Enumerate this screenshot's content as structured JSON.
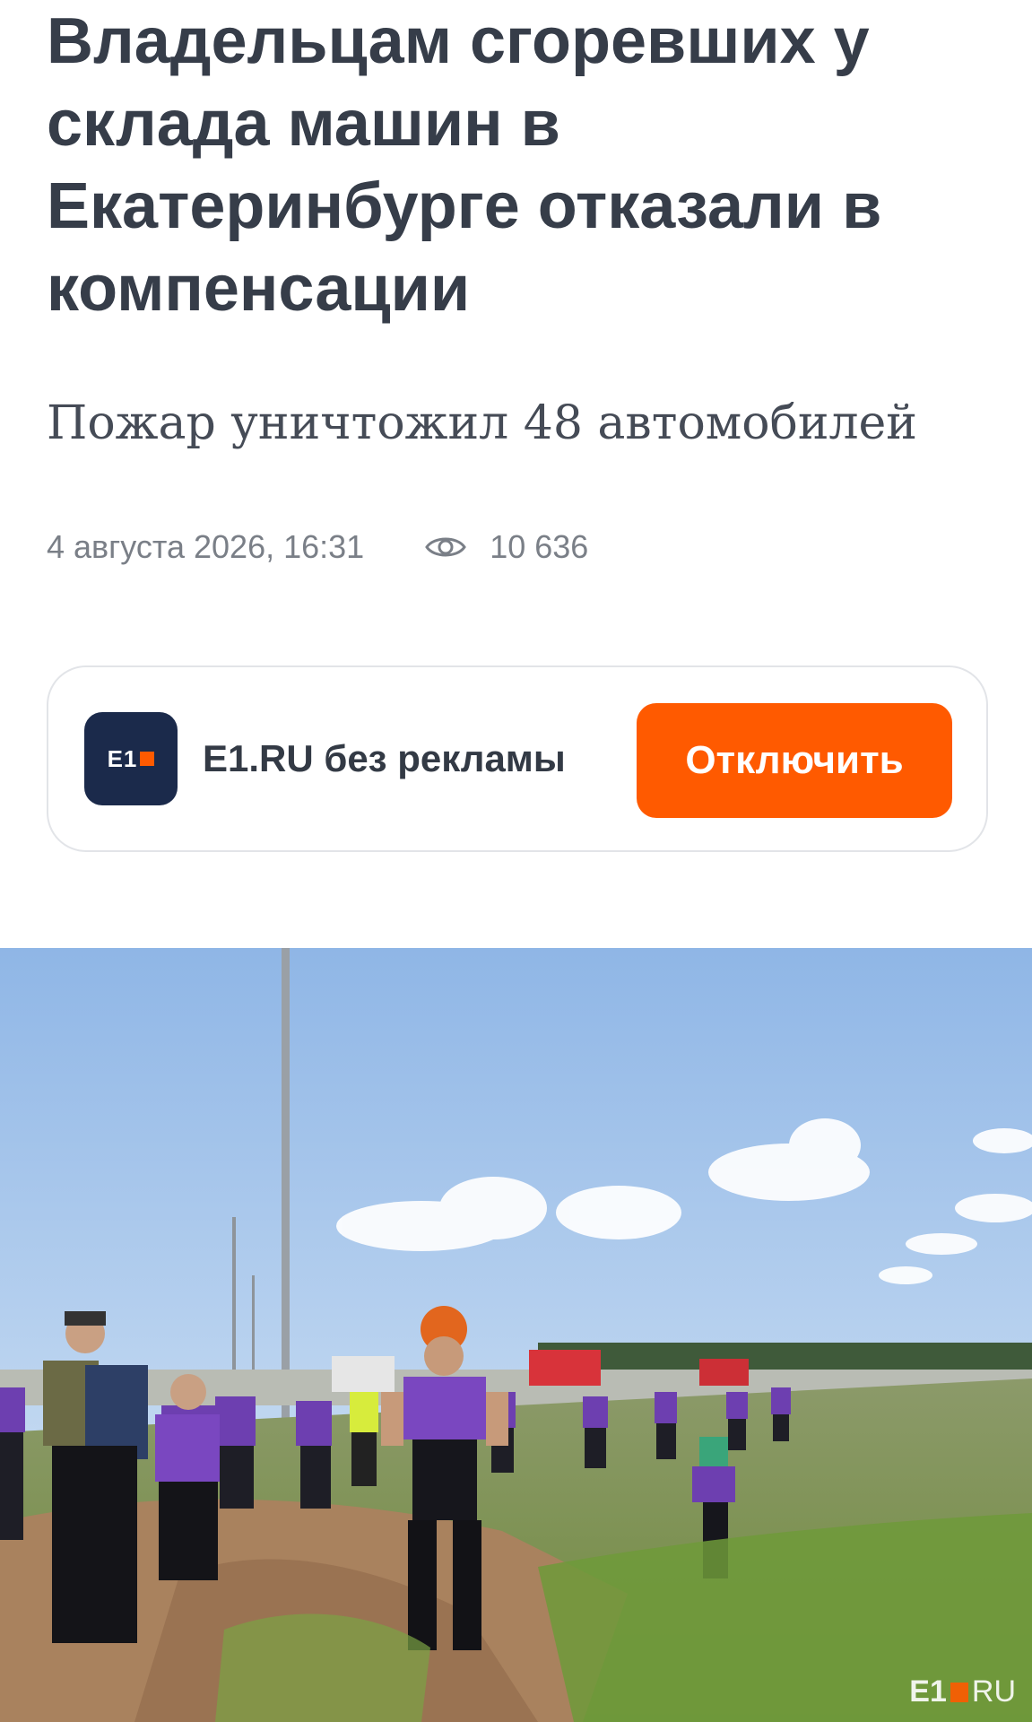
{
  "article": {
    "headline": "Владельцам сгоревших у склада машин в Екатеринбурге отказали в компенсации",
    "subtitle": "Пожар уничтожил 48 автомобилей",
    "date": "4 августа 2026, 16:31",
    "views": "10 636",
    "views_icon": "eye-icon"
  },
  "promo": {
    "logo_text": "E1",
    "label": "E1.RU без рекламы",
    "button_label": "Отключить",
    "accent_color": "#ff5a00",
    "logo_color": "#1b2a4b"
  },
  "photo": {
    "watermark_left": "E1",
    "watermark_right": "RU"
  }
}
